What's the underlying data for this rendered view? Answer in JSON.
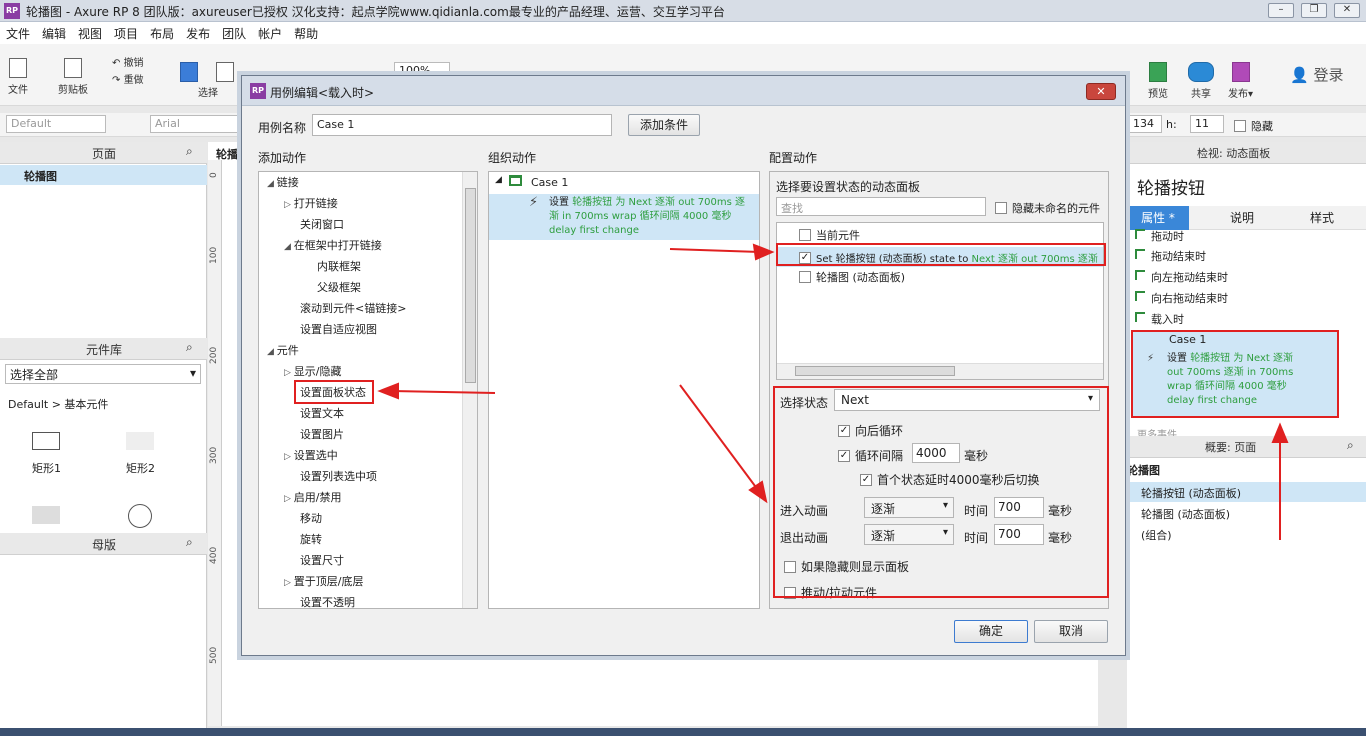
{
  "window": {
    "title": "轮播图 - Axure RP 8 团队版：axureuser已授权 汉化支持：起点学院www.qidianla.com最专业的产品经理、运营、交互学习平台",
    "logo": "RP"
  },
  "menu": [
    "文件",
    "编辑",
    "视图",
    "项目",
    "布局",
    "发布",
    "团队",
    "帐户",
    "帮助"
  ],
  "toolbar": {
    "file": "文件",
    "clipboard": "剪贴板",
    "select": "选择",
    "undo": "撤销",
    "redo": "重做",
    "zoom": "100%",
    "preview": "预览",
    "share": "共享",
    "publish": "发布",
    "login": "登录"
  },
  "format": {
    "style": "Default",
    "font": "Arial",
    "w": "134",
    "h_label": "h:",
    "h": "11",
    "hidden": "隐藏"
  },
  "pages_panel": {
    "title": "页面",
    "page": "轮播图"
  },
  "library_panel": {
    "title": "元件库",
    "select": "选择全部",
    "group": "Default > 基本元件",
    "items": [
      "矩形1",
      "矩形2"
    ]
  },
  "masters_panel": {
    "title": "母版"
  },
  "canvas": {
    "tab": "轮播",
    "ruler": [
      "0",
      "100",
      "200",
      "300",
      "400",
      "500"
    ]
  },
  "dialog": {
    "title": "用例编辑<载入时>",
    "case_label": "用例名称",
    "case_value": "Case 1",
    "add_condition": "添加条件",
    "col1": "添加动作",
    "col2": "组织动作",
    "col3": "配置动作",
    "actions": [
      {
        "t": "链接",
        "lvl": 0,
        "exp": "open"
      },
      {
        "t": "打开链接",
        "lvl": 1,
        "exp": "closed"
      },
      {
        "t": "关闭窗口",
        "lvl": 1,
        "exp": ""
      },
      {
        "t": "在框架中打开链接",
        "lvl": 1,
        "exp": "open"
      },
      {
        "t": "内联框架",
        "lvl": 2,
        "exp": ""
      },
      {
        "t": "父级框架",
        "lvl": 2,
        "exp": ""
      },
      {
        "t": "滚动到元件<锚链接>",
        "lvl": 1,
        "exp": ""
      },
      {
        "t": "设置自适应视图",
        "lvl": 1,
        "exp": ""
      },
      {
        "t": "元件",
        "lvl": 0,
        "exp": "open"
      },
      {
        "t": "显示/隐藏",
        "lvl": 1,
        "exp": "closed"
      },
      {
        "t": "设置面板状态",
        "lvl": 1,
        "exp": ""
      },
      {
        "t": "设置文本",
        "lvl": 1,
        "exp": ""
      },
      {
        "t": "设置图片",
        "lvl": 1,
        "exp": ""
      },
      {
        "t": "设置选中",
        "lvl": 1,
        "exp": "closed"
      },
      {
        "t": "设置列表选中项",
        "lvl": 1,
        "exp": ""
      },
      {
        "t": "启用/禁用",
        "lvl": 1,
        "exp": "closed"
      },
      {
        "t": "移动",
        "lvl": 1,
        "exp": ""
      },
      {
        "t": "旋转",
        "lvl": 1,
        "exp": ""
      },
      {
        "t": "设置尺寸",
        "lvl": 1,
        "exp": ""
      },
      {
        "t": "置于顶层/底层",
        "lvl": 1,
        "exp": "closed"
      },
      {
        "t": "设置不透明",
        "lvl": 1,
        "exp": ""
      }
    ],
    "org": {
      "case": "Case 1",
      "action_prefix": "设置",
      "action_green1": "轮播按钮 为 Next 逐渐 out 700ms 逐",
      "action_green2": "渐 in 700ms wrap 循环间隔 4000 毫秒",
      "action_green3": "delay first change"
    },
    "config": {
      "choose_panel": "选择要设置状态的动态面板",
      "search_placeholder": "查找",
      "hide_unnamed": "隐藏未命名的元件",
      "items": [
        "当前元件",
        "Set 轮播按钮 (动态面板) state to",
        "轮播图 (动态面板)"
      ],
      "item2_green": "Next 逐渐 out 700ms 逐渐",
      "state_label": "选择状态",
      "state_value": "Next",
      "wrap": "向后循环",
      "interval": "循环间隔",
      "interval_value": "4000",
      "ms": "毫秒",
      "first_delay": "首个状态延时4000毫秒后切换",
      "enter_anim": "进入动画",
      "exit_anim": "退出动画",
      "anim_value": "逐渐",
      "time": "时间",
      "time_value": "700",
      "show_if_hidden": "如果隐藏则显示面板",
      "push_pull": "推动/拉动元件"
    },
    "ok": "确定",
    "cancel": "取消"
  },
  "inspector": {
    "title": "检视: 动态面板",
    "name": "轮播按钮",
    "tabs": [
      "属性",
      "说明",
      "样式"
    ],
    "tab_star": "*",
    "events": [
      "拖动时",
      "拖动结束时",
      "向左拖动结束时",
      "向右拖动结束时",
      "载入时"
    ],
    "case": "Case 1",
    "case_prefix": "设置",
    "case_green1": "轮播按钮 为 Next 逐渐",
    "case_green2": "out 700ms 逐渐 in 700ms",
    "case_green3": "wrap 循环间隔 4000 毫秒",
    "case_green4": "delay first change",
    "more": "更多事件"
  },
  "outline": {
    "title": "概要: 页面",
    "root": "轮播图",
    "items": [
      "轮播按钮 (动态面板)",
      "轮播图 (动态面板)",
      "(组合)"
    ]
  }
}
